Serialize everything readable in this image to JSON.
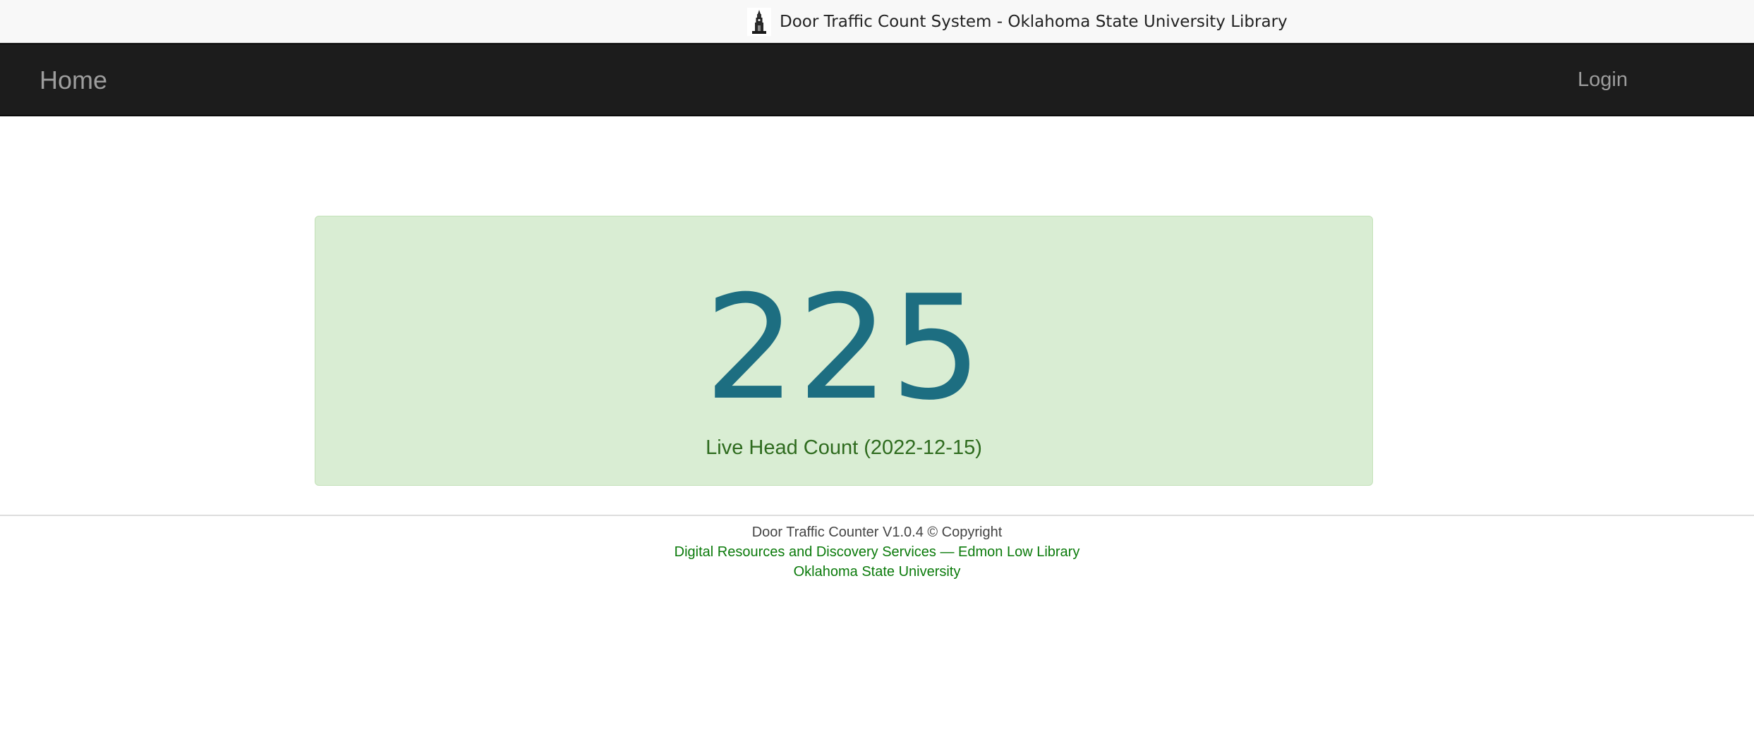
{
  "header": {
    "title": "Door Traffic Count System - Oklahoma State University Library",
    "logo_icon": "library-tower-icon"
  },
  "nav": {
    "home_label": "Home",
    "login_label": "Login"
  },
  "counter": {
    "value": "225",
    "label": "Live Head Count (2022-12-15)"
  },
  "footer": {
    "version_text": "Door Traffic Counter V1.0.4 © Copyright",
    "dept_link": "Digital Resources and Discovery Services — Edmon Low Library",
    "university_link": "Oklahoma State University"
  },
  "colors": {
    "navbar_bg": "#1c1c1c",
    "card_bg": "#d9edd3",
    "count_color": "#1d6e81",
    "label_color": "#2e6b1e",
    "link_color": "#0a7a0a"
  }
}
